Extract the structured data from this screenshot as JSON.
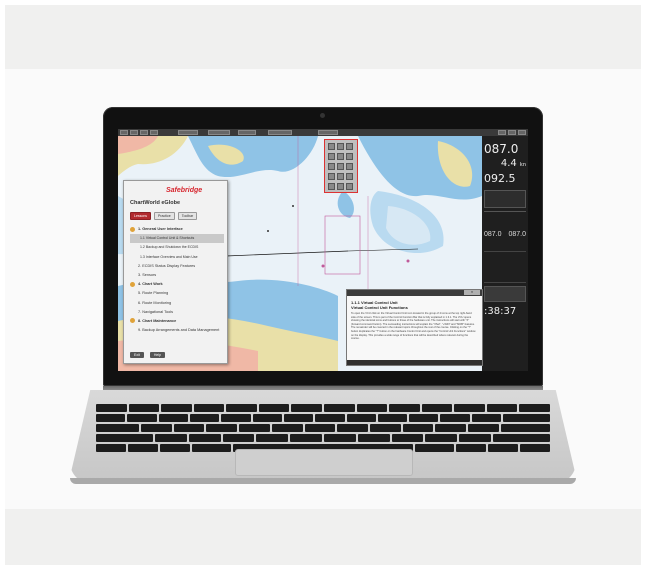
{
  "chart_app": {
    "logo": "Safebridge",
    "title": "ChartWorld eGlobe",
    "tabs": [
      "Lessons",
      "Practice",
      "Toolbar"
    ],
    "items": [
      {
        "label": "1. General User Interface",
        "kind": "section"
      },
      {
        "label": "1.1 Virtual Control Unit & Shortcuts",
        "kind": "sub",
        "selected": true
      },
      {
        "label": "1.2 Backup and Shutdown the ECDIS",
        "kind": "sub"
      },
      {
        "label": "1.3 Interface Overview and Main Use",
        "kind": "sub"
      },
      {
        "label": "2. ECDIS Status Display Features",
        "kind": "plain"
      },
      {
        "label": "3. Sensors",
        "kind": "plain"
      },
      {
        "label": "4. Chart Work",
        "kind": "section"
      },
      {
        "label": "5. Route Planning",
        "kind": "plain"
      },
      {
        "label": "6. Route Monitoring",
        "kind": "plain"
      },
      {
        "label": "7. Navigational Tools",
        "kind": "plain"
      },
      {
        "label": "8. Chart Maintenance",
        "kind": "section"
      },
      {
        "label": "9. Backup Arrangements and Data Management",
        "kind": "plain"
      }
    ],
    "buttons": [
      "Exit",
      "Help"
    ]
  },
  "info_panel": {
    "heading": "1.1.1 Virtual Control Unit",
    "subheading": "Virtual Control Unit Functions",
    "body": "To open the VCU click on the Virtual Control Unit icon located in the group of 4 icons at the top right-hand side of the screen. This is part of the Control Function Bar that is fully explained in 1.3.1. The VCU opens showing the identical icons and buttons to those of the hardware unit. The instructions will start with \"X\" (Foward command button). The succeeding instructions will explain the \"XSel\", \"+WIN\" and \"MOB\" features. The remainder will be covered in the relevant topics throughout the rest of the course. Clicking on the \"?\" button duplicates the \"?\" button on the hardware Control Unit and opens the \"Control Unit Functions\" window on the display. This provides a wide range of functions that will be described where relevant during the course."
  },
  "sidebar": {
    "heading": "087.0",
    "speed": "4.4",
    "speed_unit": "kn",
    "course": "092.5",
    "readings": [
      "087.0",
      "087.0"
    ],
    "time": ":38:37"
  },
  "colors": {
    "land": "#e9e0a8",
    "shallow": "#8fc3e6",
    "deep": "#e8f1f8",
    "accent": "#b22a2f"
  }
}
